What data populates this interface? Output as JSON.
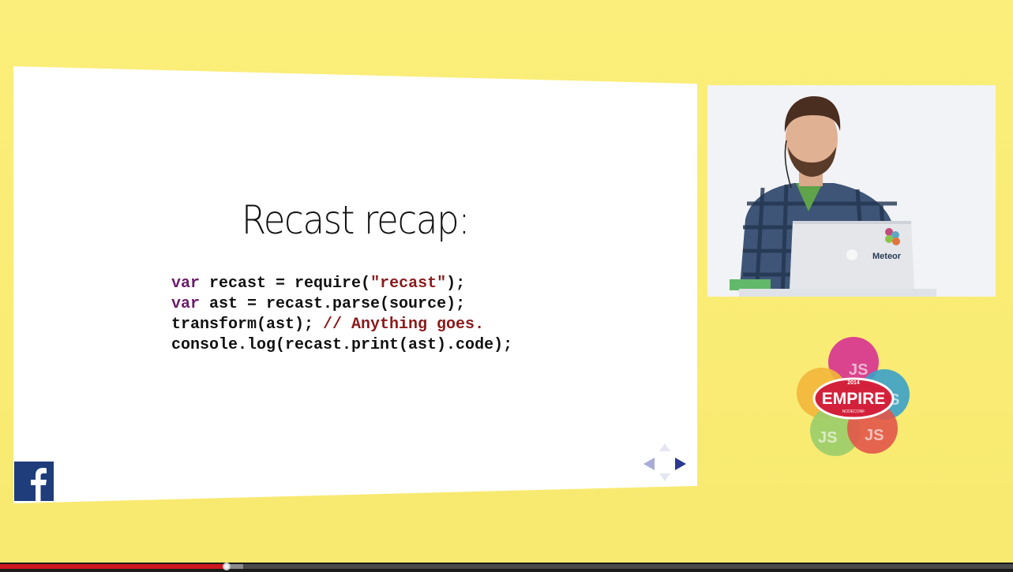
{
  "slide": {
    "title": "Recast recap:",
    "code": {
      "line1": {
        "kw": "var",
        "a": " recast = require(",
        "str": "\"recast\"",
        "b": ");"
      },
      "line2": {
        "kw": "var",
        "a": " ast = recast.parse(source);"
      },
      "line3": {
        "a": "transform(ast); ",
        "comment": "// Anything goes."
      },
      "line4": {
        "a": "console.log(recast.print(ast).code);"
      }
    },
    "icons": {
      "social": "facebook-icon",
      "nav_left": "nav-left-arrow-icon",
      "nav_right": "nav-right-arrow-icon",
      "nav_up": "nav-up-arrow-icon",
      "nav_down": "nav-down-arrow-icon"
    }
  },
  "webcam": {
    "laptop_label": "Meteor"
  },
  "event_logo": {
    "year": "2014",
    "name": "EMPIRE",
    "tagline": "NODECONF",
    "js_labels": [
      "JS",
      "JS",
      "JS",
      "JS"
    ]
  },
  "player": {
    "progress_fraction": 0.224,
    "buffered_fraction": 0.24
  },
  "colors": {
    "background": "#f9ec75",
    "played": "#cc181e",
    "facebook": "#1e3d7a",
    "keyword": "#6b1b6b",
    "string": "#8b1a1a"
  }
}
